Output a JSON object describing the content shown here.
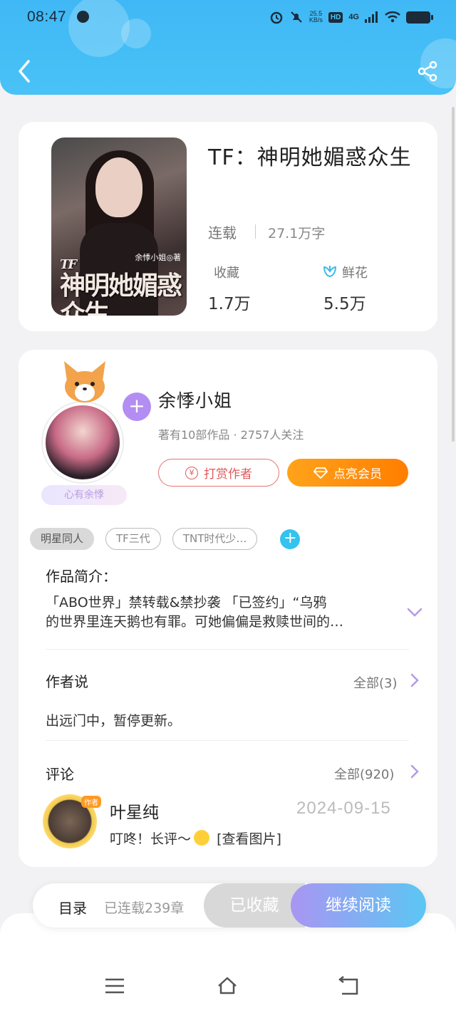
{
  "status_bar": {
    "time": "08:47",
    "speed_value": "25.5",
    "speed_unit": "KB/s",
    "hd": "HD",
    "network": "4G"
  },
  "colors": {
    "header_blue": "#49c2f7",
    "accent_purple": "#b38df2",
    "tip_red": "#e05a5a",
    "vip_orange": "#ff8a00",
    "tag_plus_blue": "#32c3ef"
  },
  "book": {
    "cover_title": "神明她媚惑众生",
    "cover_prefix": "TF",
    "cover_author": "余悸小姐◎著",
    "title": "TF：神明她媚惑众生",
    "status": "连载",
    "words": "27.1万字",
    "collect_label": "收藏",
    "collect_value": "1.7万",
    "flower_label": "鲜花",
    "flower_value": "5.5万"
  },
  "author": {
    "name": "余悸小姐",
    "meta": "著有10部作品 · 2757人关注",
    "pendant": "心有余悸",
    "tip_button": "打赏作者",
    "vip_button": "点亮会员",
    "tags": [
      "明星同人",
      "TF三代",
      "TNT时代少…"
    ]
  },
  "intro": {
    "label": "作品简介：",
    "line1": "「ABO世界」禁转载&禁抄袭 「已签约」“乌鸦",
    "line2": "的世界里连天鹅也有罪。可她偏偏是救赎世间的…"
  },
  "author_say": {
    "label": "作者说",
    "all": "全部(3)",
    "text": "出远门中，暂停更新。"
  },
  "comments": {
    "label": "评论",
    "all": "全部(920)",
    "items": [
      {
        "badge": "作者",
        "name": "叶星纯",
        "date": "2024-09-15",
        "text_pre": "叮咚！长评～",
        "text_post": "[查看图片]"
      }
    ]
  },
  "bottom_bar": {
    "toc": "目录",
    "toc_info": "已连载239章",
    "collected": "已收藏",
    "continue": "继续阅读"
  },
  "icons": [
    "back-icon",
    "share-icon",
    "flower-icon",
    "plus-icon",
    "chevron-down-icon",
    "chevron-right-icon",
    "menu-icon",
    "home-icon",
    "back-nav-icon"
  ]
}
